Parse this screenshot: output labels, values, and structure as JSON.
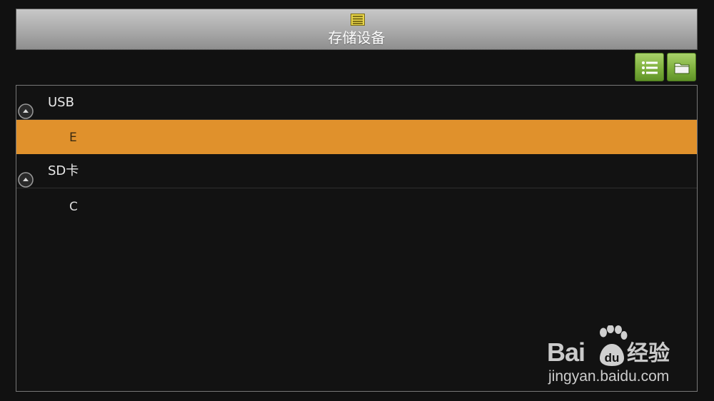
{
  "header": {
    "title": "存储设备",
    "icon": "list-document-icon"
  },
  "toolbar": {
    "list_view_icon": "list-view-icon",
    "folder_view_icon": "folder-icon"
  },
  "tree": {
    "groups": [
      {
        "label": "USB",
        "expand_icon": "collapse-up-icon",
        "children": [
          {
            "label": "E",
            "selected": true
          }
        ]
      },
      {
        "label": "SD卡",
        "expand_icon": "collapse-up-icon",
        "children": [
          {
            "label": "C",
            "selected": false
          }
        ]
      }
    ]
  },
  "watermark": {
    "brand_left": "Bai",
    "brand_right": "经验",
    "url": "jingyan.baidu.com"
  },
  "colors": {
    "background": "#111111",
    "selection": "#e0912c",
    "button_green": "#7fb13e",
    "titlebar": "#a9a9a9",
    "title_icon": "#e8d54a"
  }
}
